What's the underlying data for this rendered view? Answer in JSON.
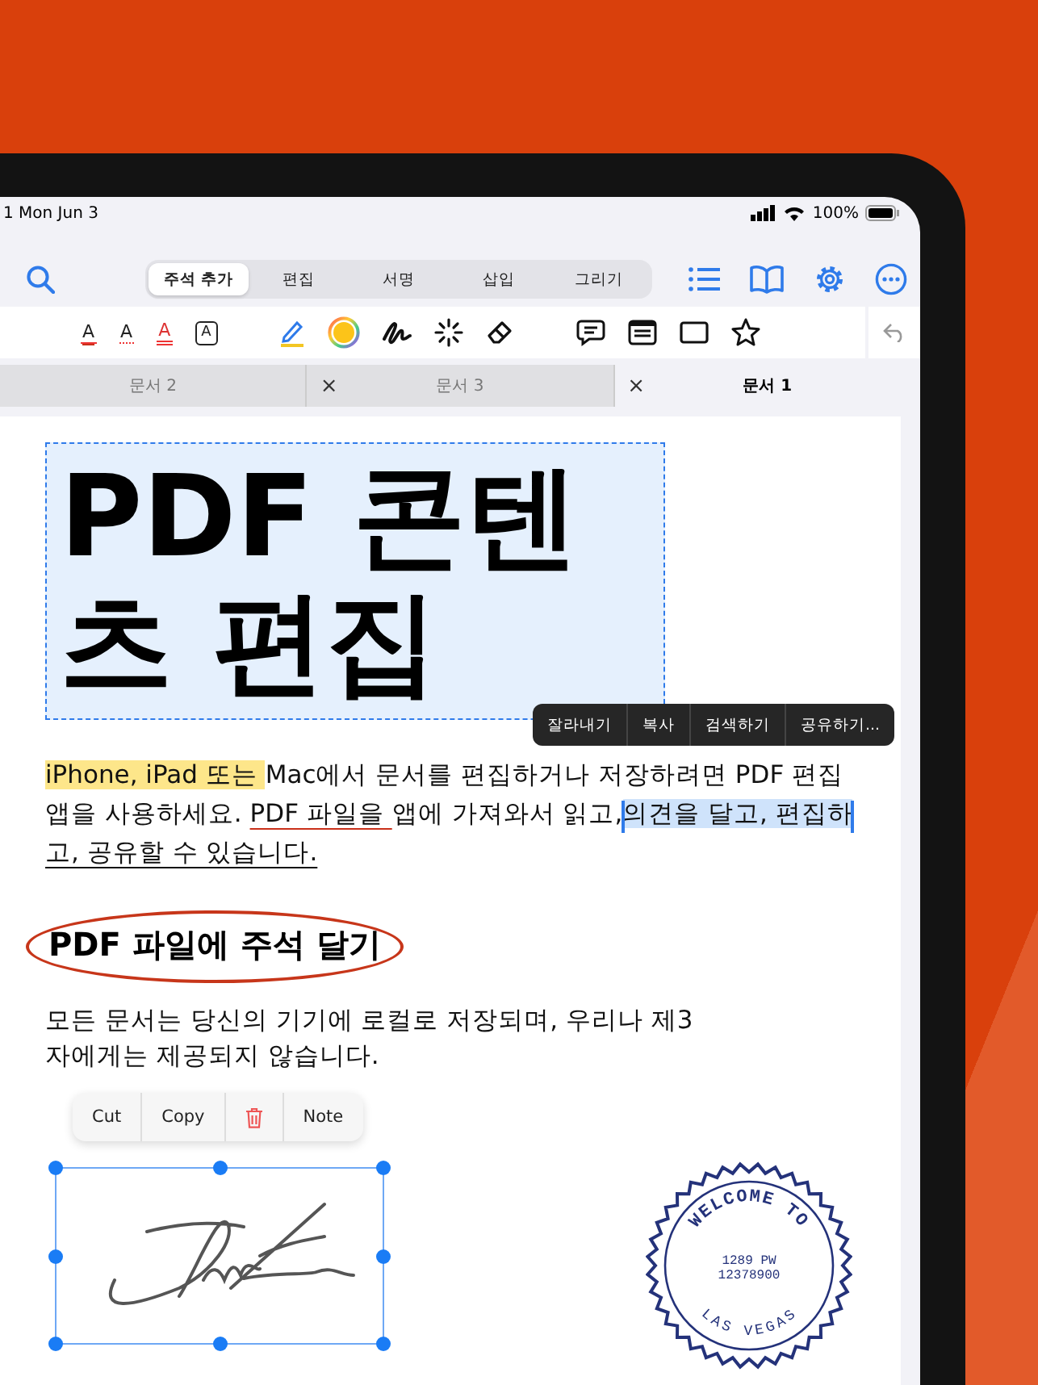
{
  "status_bar": {
    "time": "1 Mon Jun 3",
    "battery": "100%"
  },
  "modes": [
    {
      "label": "주석 추가",
      "selected": true
    },
    {
      "label": "편집",
      "selected": false
    },
    {
      "label": "서명",
      "selected": false
    },
    {
      "label": "삽입",
      "selected": false
    },
    {
      "label": "그리기",
      "selected": false
    }
  ],
  "text_tools": [
    {
      "kind": "underline",
      "glyph": "A"
    },
    {
      "kind": "squiggly",
      "glyph": "A"
    },
    {
      "kind": "strike",
      "glyph": "A"
    },
    {
      "kind": "boxed",
      "glyph": "A"
    }
  ],
  "doc_tabs": [
    {
      "label": "문서 2",
      "selected": false
    },
    {
      "label": "문서 3",
      "close": "×",
      "selected": false
    },
    {
      "label": "문서 1",
      "close": "×",
      "selected": true
    }
  ],
  "title": "PDF 콘텐츠 편집",
  "paragraph": [
    {
      "kind": "highlight",
      "text": "iPhone, iPad 또는 "
    },
    {
      "kind": "plain",
      "text": "Mac에서 문서를 편집하거나 저장하려면 PDF 편집 앱을 사용하세요. "
    },
    {
      "kind": "underline",
      "text": "PDF 파일을 "
    },
    {
      "kind": "plain",
      "text": "앱에 가져와서 읽고,"
    },
    {
      "kind": "selected",
      "text": "의견을 달고, 편집하"
    },
    {
      "kind": "underline-dark",
      "text": "고, 공유할 수 있습니다. "
    }
  ],
  "text_menu": [
    "잘라내기",
    "복사",
    "검색하기",
    "공유하기..."
  ],
  "heading": "PDF 파일에 주석 달기",
  "body": "모든 문서는 당신의 기기에 로컬로 저장되며, 우리나 제3자에게는 제공되지 않습니다.",
  "edit_menu": [
    {
      "kind": "text",
      "label": "Cut"
    },
    {
      "kind": "text",
      "label": "Copy"
    },
    {
      "kind": "delete"
    },
    {
      "kind": "text",
      "label": "Note"
    }
  ],
  "stamp": {
    "top": "WELCOME TO",
    "line_1": "1289 PW",
    "line_2": "12378900",
    "bottom": "LAS VEGAS"
  }
}
